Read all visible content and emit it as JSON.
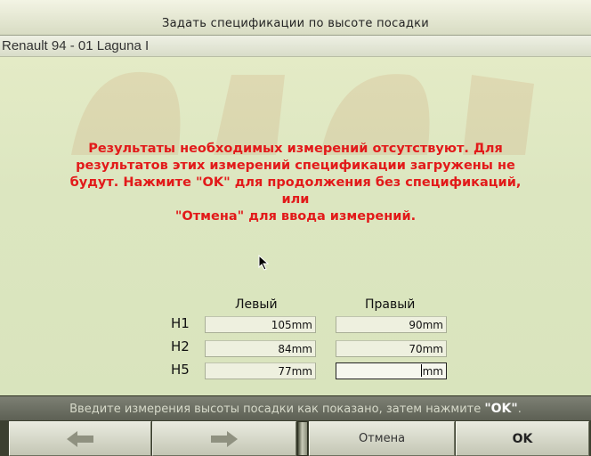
{
  "window": {
    "title": "Задать спецификации по высоте посадки",
    "vehicle": "Renault 94 - 01 Laguna I"
  },
  "message": {
    "line1": "Результаты необходимых измерений отсутствуют. Для",
    "line2": "результатов этих измерений спецификации загружены не",
    "line3": "будут. Нажмите \"OK\" для продолжения без спецификаций, или",
    "line4": "\"Отмена\" для ввода измерений.",
    "color": "#e21a1a"
  },
  "measurements": {
    "left_header": "Левый",
    "right_header": "Правый",
    "unit": "mm",
    "rows": [
      {
        "label": "H1",
        "left": "105",
        "right": "90"
      },
      {
        "label": "H2",
        "left": "84",
        "right": "70"
      },
      {
        "label": "H5",
        "left": "77",
        "right": ""
      }
    ]
  },
  "status": {
    "text": "Введите измерения высоты посадки как показано, затем нажмите ",
    "key": "\"OK\"",
    "end": "."
  },
  "footer": {
    "back_icon": "arrow-left-icon",
    "forward_icon": "arrow-right-icon",
    "cancel_label": "Отмена",
    "ok_label": "OK"
  }
}
